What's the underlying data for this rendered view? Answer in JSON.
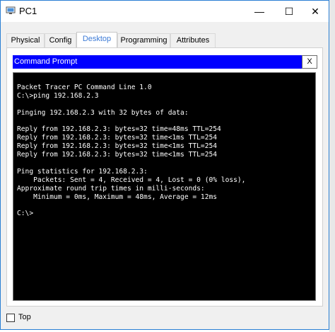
{
  "window": {
    "title": "PC1",
    "minimize_glyph": "—",
    "maximize_glyph": "☐",
    "close_glyph": "✕"
  },
  "tabs": [
    {
      "label": "Physical",
      "active": false
    },
    {
      "label": "Config",
      "active": false
    },
    {
      "label": "Desktop",
      "active": true
    },
    {
      "label": "Programming",
      "active": false
    },
    {
      "label": "Attributes",
      "active": false
    }
  ],
  "command_prompt": {
    "title": "Command Prompt",
    "close_label": "X",
    "lines": [
      "Packet Tracer PC Command Line 1.0",
      "C:\\>ping 192.168.2.3",
      "",
      "Pinging 192.168.2.3 with 32 bytes of data:",
      "",
      "Reply from 192.168.2.3: bytes=32 time=48ms TTL=254",
      "Reply from 192.168.2.3: bytes=32 time<1ms TTL=254",
      "Reply from 192.168.2.3: bytes=32 time<1ms TTL=254",
      "Reply from 192.168.2.3: bytes=32 time<1ms TTL=254",
      "",
      "Ping statistics for 192.168.2.3:",
      "    Packets: Sent = 4, Received = 4, Lost = 0 (0% loss),",
      "Approximate round trip times in milli-seconds:",
      "    Minimum = 0ms, Maximum = 48ms, Average = 12ms",
      "",
      "C:\\>"
    ]
  },
  "footer": {
    "top_label": "Top",
    "top_checked": false
  },
  "colors": {
    "accent_tab": "#3d7bd6",
    "cmd_titlebar": "#0000ff",
    "terminal_bg": "#000000",
    "terminal_fg": "#ffffff",
    "window_border": "#2a7fd4"
  }
}
